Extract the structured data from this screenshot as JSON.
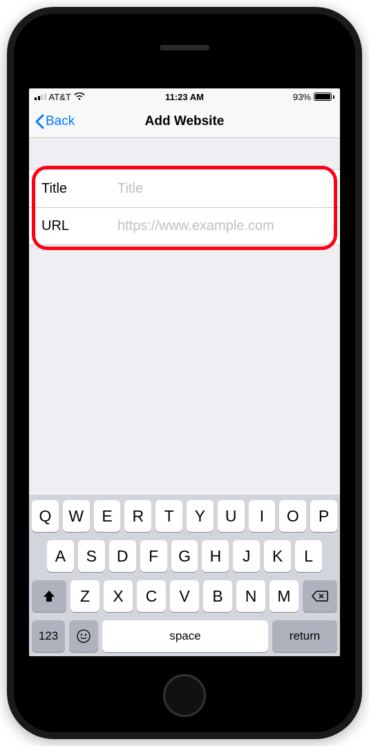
{
  "status": {
    "carrier": "AT&T",
    "time": "11:23 AM",
    "battery_percent": "93%"
  },
  "nav": {
    "back_label": "Back",
    "title": "Add Website"
  },
  "form": {
    "title_label": "Title",
    "title_placeholder": "Title",
    "title_value": "",
    "url_label": "URL",
    "url_placeholder": "https://www.example.com",
    "url_value": ""
  },
  "keyboard": {
    "row1": [
      "Q",
      "W",
      "E",
      "R",
      "T",
      "Y",
      "U",
      "I",
      "O",
      "P"
    ],
    "row2": [
      "A",
      "S",
      "D",
      "F",
      "G",
      "H",
      "J",
      "K",
      "L"
    ],
    "row3": [
      "Z",
      "X",
      "C",
      "V",
      "B",
      "N",
      "M"
    ],
    "mode_key": "123",
    "space_label": "space",
    "return_label": "return"
  }
}
